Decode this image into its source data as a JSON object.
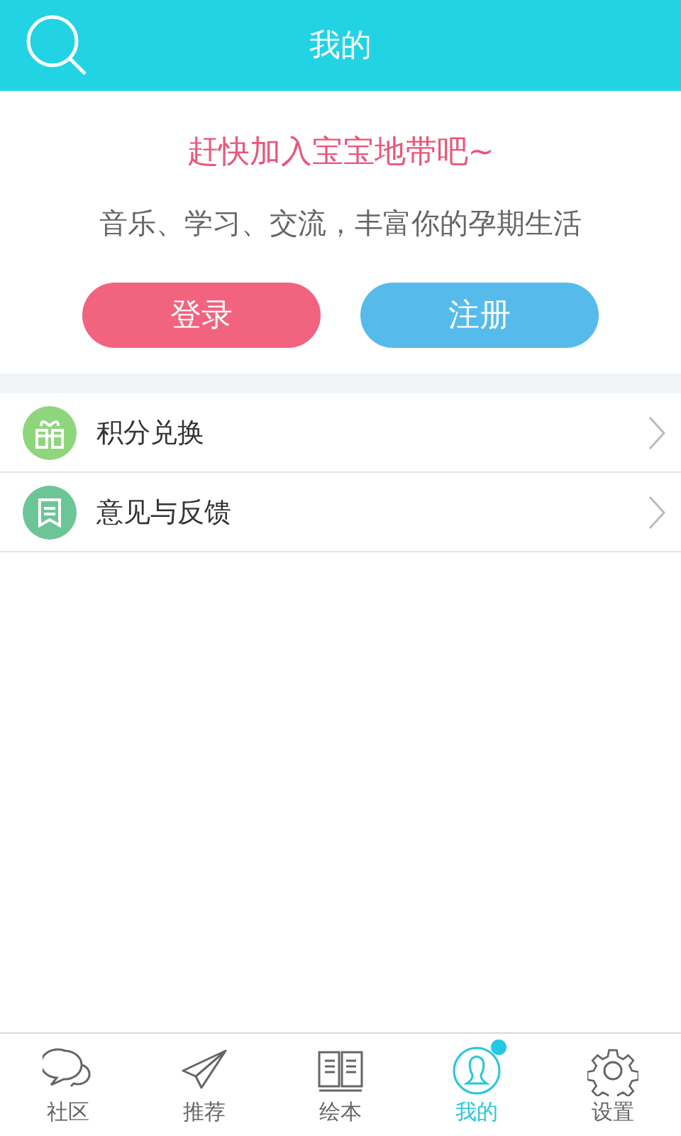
{
  "header": {
    "title": "我的"
  },
  "welcome": {
    "headline": "赶快加入宝宝地带吧~",
    "tagline": "音乐、学习、交流，丰富你的孕期生活",
    "buttons": [
      {
        "kind": "login",
        "label": "登录"
      },
      {
        "kind": "register",
        "label": "注册"
      }
    ]
  },
  "menu": [
    {
      "kind": "gift",
      "label": "积分兑换",
      "color": "#8ed67c"
    },
    {
      "kind": "feedback",
      "label": "意见与反馈",
      "color": "#6cc596"
    }
  ],
  "tabs": [
    {
      "kind": "community",
      "label": "社区",
      "selected": false,
      "dot": false
    },
    {
      "kind": "recommend",
      "label": "推荐",
      "selected": false,
      "dot": false
    },
    {
      "kind": "books",
      "label": "绘本",
      "selected": false,
      "dot": false
    },
    {
      "kind": "me",
      "label": "我的",
      "selected": true,
      "dot": true
    },
    {
      "kind": "settings",
      "label": "设置",
      "selected": false,
      "dot": false
    }
  ]
}
